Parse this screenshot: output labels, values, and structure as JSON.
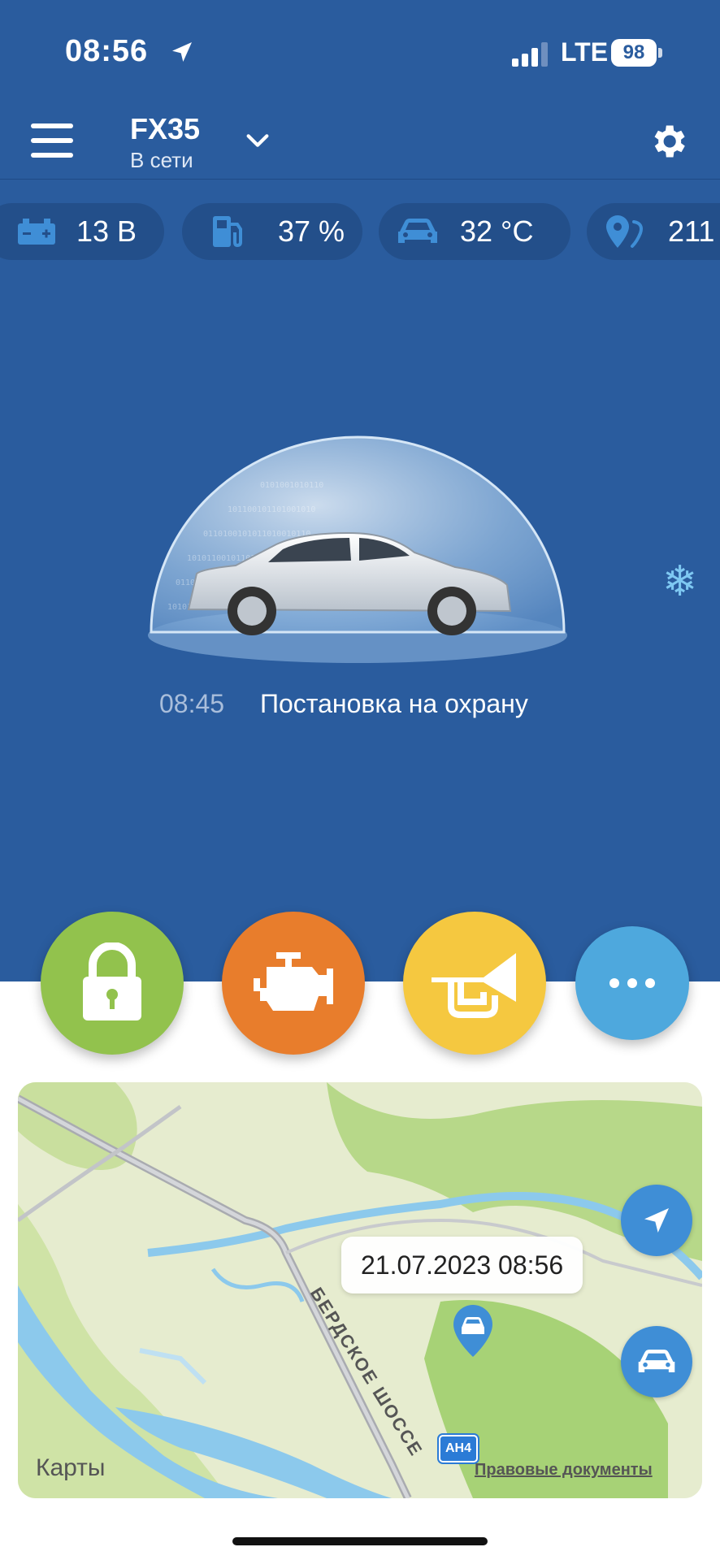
{
  "status_bar": {
    "time": "08:56",
    "network": "LTE",
    "battery": "98"
  },
  "header": {
    "car_name": "FX35",
    "car_status": "В сети"
  },
  "chips": [
    {
      "icon": "battery-icon",
      "value": "13 В"
    },
    {
      "icon": "fuel-icon",
      "value": "37 %"
    },
    {
      "icon": "car-temp-icon",
      "value": "32 °C"
    },
    {
      "icon": "location-pin-icon",
      "value": "211"
    }
  ],
  "event": {
    "time": "08:45",
    "text": "Постановка на охрану"
  },
  "actions": [
    {
      "name": "lock",
      "icon": "padlock-icon",
      "color": "#92c24d"
    },
    {
      "name": "engine",
      "icon": "engine-icon",
      "color": "#e87d2c"
    },
    {
      "name": "horn",
      "icon": "horn-icon",
      "color": "#f5c840"
    },
    {
      "name": "more",
      "icon": "more-dots-icon",
      "color": "#4ea8dd"
    }
  ],
  "map": {
    "date_label": "21.07.2023 08:56",
    "street": "БЕРДСКОЕ ШОССЕ",
    "road_badge": "АН4",
    "logo": "Карты",
    "legal": "Правовые документы"
  },
  "colors": {
    "primary": "#2a5c9e",
    "chip": "#234f8a",
    "accent_blue": "#3f8ed6"
  }
}
